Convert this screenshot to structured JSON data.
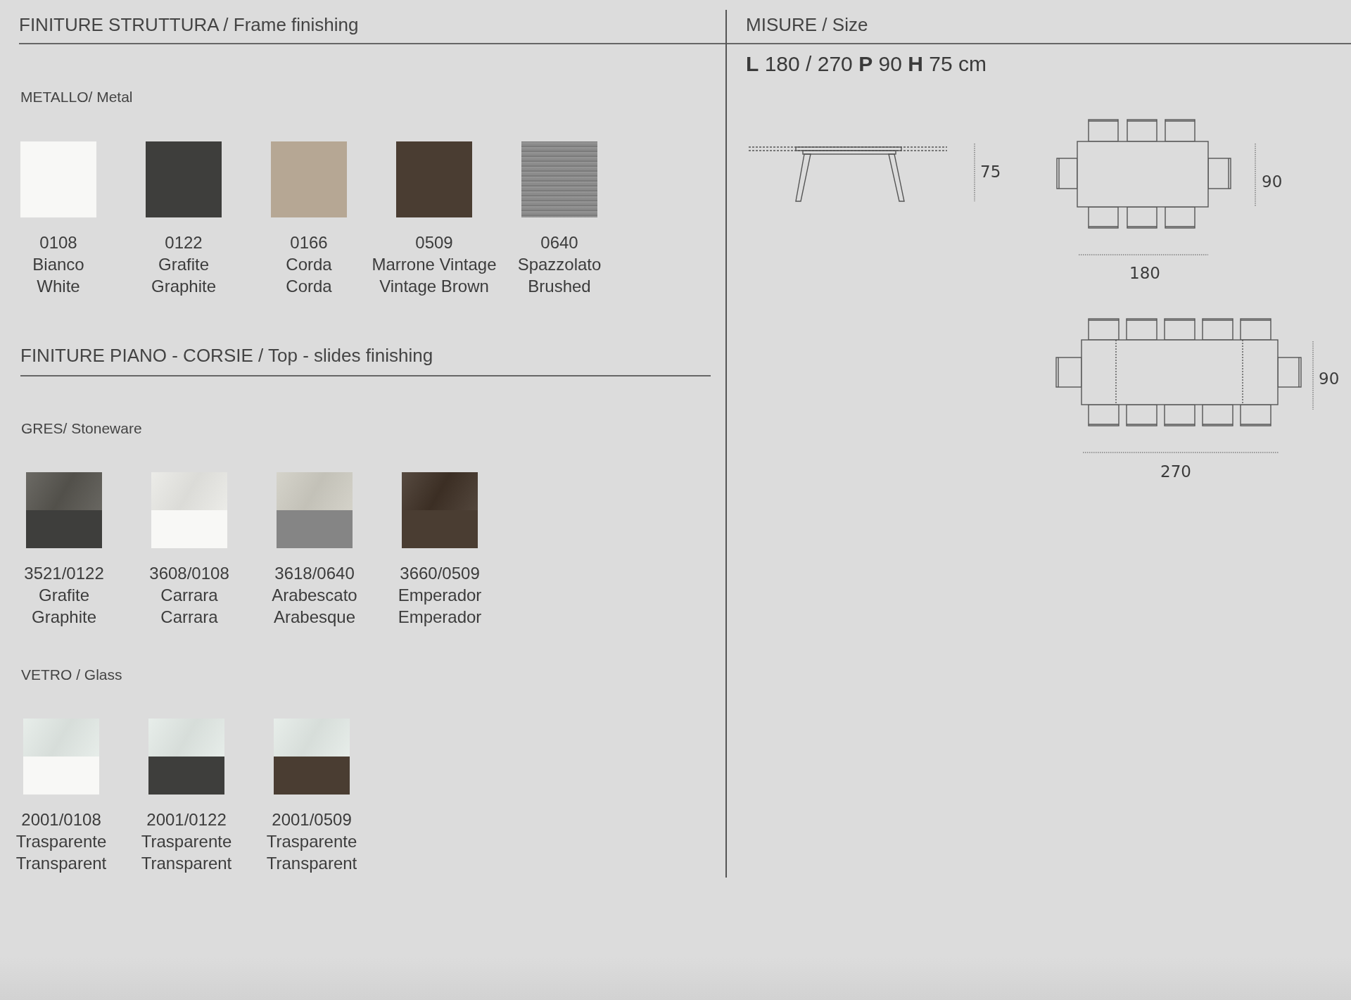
{
  "finishes": [
    {
      "title": "FINITURE STRUTTURA / Frame finishing",
      "groups": [
        {
          "title": "METALLO/ Metal",
          "swatches": [
            {
              "code": "0108",
              "name_it": "Bianco",
              "name_en": "White",
              "kind": "solid",
              "color": "#f8f8f6"
            },
            {
              "code": "0122",
              "name_it": "Grafite",
              "name_en": "Graphite",
              "kind": "solid",
              "color": "#3e3e3c"
            },
            {
              "code": "0166",
              "name_it": "Corda",
              "name_en": "Corda",
              "kind": "solid",
              "color": "#b6a794"
            },
            {
              "code": "0509",
              "name_it": "Marrone Vintage",
              "name_en": "Vintage Brown",
              "kind": "solid",
              "color": "#4a3d32"
            },
            {
              "code": "0640",
              "name_it": "Spazzolato",
              "name_en": "Brushed",
              "kind": "brushed",
              "color": "#858585"
            }
          ]
        }
      ]
    },
    {
      "title": "FINITURE PIANO - CORSIE / Top - slides finishing",
      "groups": [
        {
          "title": "GRES/ Stoneware",
          "swatches": [
            {
              "code": "3521/0122",
              "name_it": "Grafite",
              "name_en": "Graphite",
              "kind": "split",
              "parts": [
                {
                  "color": "#57554f"
                },
                {
                  "color": "#3e3e3c"
                }
              ]
            },
            {
              "code": "3608/0108",
              "name_it": "Carrara",
              "name_en": "Carrara",
              "kind": "split",
              "parts": [
                {
                  "color": "#e9e9e5"
                },
                {
                  "color": "#f8f8f6"
                }
              ]
            },
            {
              "code": "3618/0640",
              "name_it": "Arabescato",
              "name_en": "Arabesque",
              "kind": "split",
              "parts": [
                {
                  "color": "#cfcdc3"
                },
                {
                  "color": "#858585"
                }
              ]
            },
            {
              "code": "3660/0509",
              "name_it": "Emperador",
              "name_en": "Emperador",
              "kind": "split",
              "parts": [
                {
                  "color": "#3f3126"
                },
                {
                  "color": "#4a3d32"
                }
              ]
            }
          ]
        },
        {
          "title": "VETRO / Glass",
          "swatches": [
            {
              "code": "2001/0108",
              "name_it": "Trasparente",
              "name_en": "Transparent",
              "kind": "split",
              "parts": [
                {
                  "color": "#e4ebe7"
                },
                {
                  "color": "#f8f8f6"
                }
              ]
            },
            {
              "code": "2001/0122",
              "name_it": "Trasparente",
              "name_en": "Transparent",
              "kind": "split",
              "parts": [
                {
                  "color": "#e4ebe7"
                },
                {
                  "color": "#3e3e3c"
                }
              ]
            },
            {
              "code": "2001/0509",
              "name_it": "Trasparente",
              "name_en": "Transparent",
              "kind": "split",
              "parts": [
                {
                  "color": "#e4ebe7"
                },
                {
                  "color": "#4a3d32"
                }
              ]
            }
          ]
        }
      ]
    }
  ],
  "size": {
    "title": "MISURE / Size",
    "dimensions": "**L** 180 / 270 **P** 90 **H** 75 cm",
    "side_view": {
      "height_label": "75"
    },
    "plan_small": {
      "depth_label": "90",
      "length_label": "180"
    },
    "plan_large": {
      "depth_label": "90",
      "length_label": "270"
    }
  }
}
